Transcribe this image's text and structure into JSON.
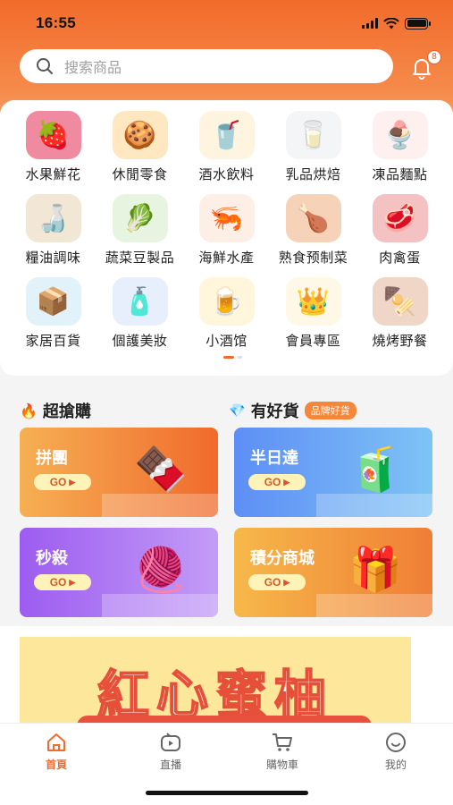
{
  "status_bar": {
    "time": "16:55"
  },
  "search": {
    "placeholder": "搜索商品"
  },
  "notifications": {
    "count": "8"
  },
  "categories": [
    {
      "label": "水果鮮花",
      "icon": "strawberry-icon",
      "bg": "#f08aa0",
      "glyph": "🍓"
    },
    {
      "label": "休閒零食",
      "icon": "snacks-icon",
      "bg": "#ffe7c2",
      "glyph": "🍪"
    },
    {
      "label": "酒水飲料",
      "icon": "drinks-icon",
      "bg": "#fff4e0",
      "glyph": "🥤"
    },
    {
      "label": "乳品烘焙",
      "icon": "dairy-icon",
      "bg": "#f3f5f7",
      "glyph": "🥛"
    },
    {
      "label": "凍品麵點",
      "icon": "icecream-icon",
      "bg": "#fff0f0",
      "glyph": "🍨"
    },
    {
      "label": "糧油調味",
      "icon": "condiments-icon",
      "bg": "#f2e6d4",
      "glyph": "🍶"
    },
    {
      "label": "蔬菜豆製品",
      "icon": "vegetable-icon",
      "bg": "#e6f4e0",
      "glyph": "🥬"
    },
    {
      "label": "海鮮水產",
      "icon": "seafood-icon",
      "bg": "#fdeee6",
      "glyph": "🦐"
    },
    {
      "label": "熟食预制菜",
      "icon": "cooked-food-icon",
      "bg": "#f6d3b8",
      "glyph": "🍗"
    },
    {
      "label": "肉禽蛋",
      "icon": "meat-icon",
      "bg": "#f4c2c2",
      "glyph": "🥩"
    },
    {
      "label": "家居百貨",
      "icon": "storage-box-icon",
      "bg": "#e2f2fb",
      "glyph": "📦"
    },
    {
      "label": "個護美妝",
      "icon": "toothpaste-icon",
      "bg": "#e6effb",
      "glyph": "🧴"
    },
    {
      "label": "小酒馆",
      "icon": "beer-icon",
      "bg": "#fff6dc",
      "glyph": "🍺"
    },
    {
      "label": "會員專區",
      "icon": "vip-icon",
      "bg": "#fff8e6",
      "glyph": "👑"
    },
    {
      "label": "燒烤野餐",
      "icon": "bbq-icon",
      "bg": "#f0d6c6",
      "glyph": "🍢"
    }
  ],
  "sections": {
    "left_title": "超搶購",
    "right_title": "有好貨",
    "right_tag": "品牌好貨"
  },
  "promos": [
    {
      "title": "拼團",
      "go": "GO",
      "icon": "wafer-snack-icon",
      "glyph": "🍫",
      "colors": [
        "#f6b054",
        "#f06a2c"
      ]
    },
    {
      "title": "半日達",
      "go": "GO",
      "icon": "juice-icon",
      "glyph": "🧃",
      "colors": [
        "#5e8ef5",
        "#7ec3f5"
      ]
    },
    {
      "title": "秒殺",
      "go": "GO",
      "icon": "sweater-icon",
      "glyph": "🧶",
      "colors": [
        "#9d5cf0",
        "#c39cf7"
      ]
    },
    {
      "title": "積分商城",
      "go": "GO",
      "icon": "gift-box-icon",
      "glyph": "🎁",
      "colors": [
        "#f6b84a",
        "#f07e36"
      ]
    }
  ],
  "banner": {
    "text": "紅心蜜柚"
  },
  "tabs": [
    {
      "label": "首頁",
      "icon": "home-icon",
      "active": true
    },
    {
      "label": "直播",
      "icon": "live-icon",
      "active": false
    },
    {
      "label": "購物車",
      "icon": "cart-icon",
      "active": false
    },
    {
      "label": "我的",
      "icon": "profile-icon",
      "active": false
    }
  ],
  "colors": {
    "accent": "#f36a2c",
    "go_text": "#d8562a"
  }
}
